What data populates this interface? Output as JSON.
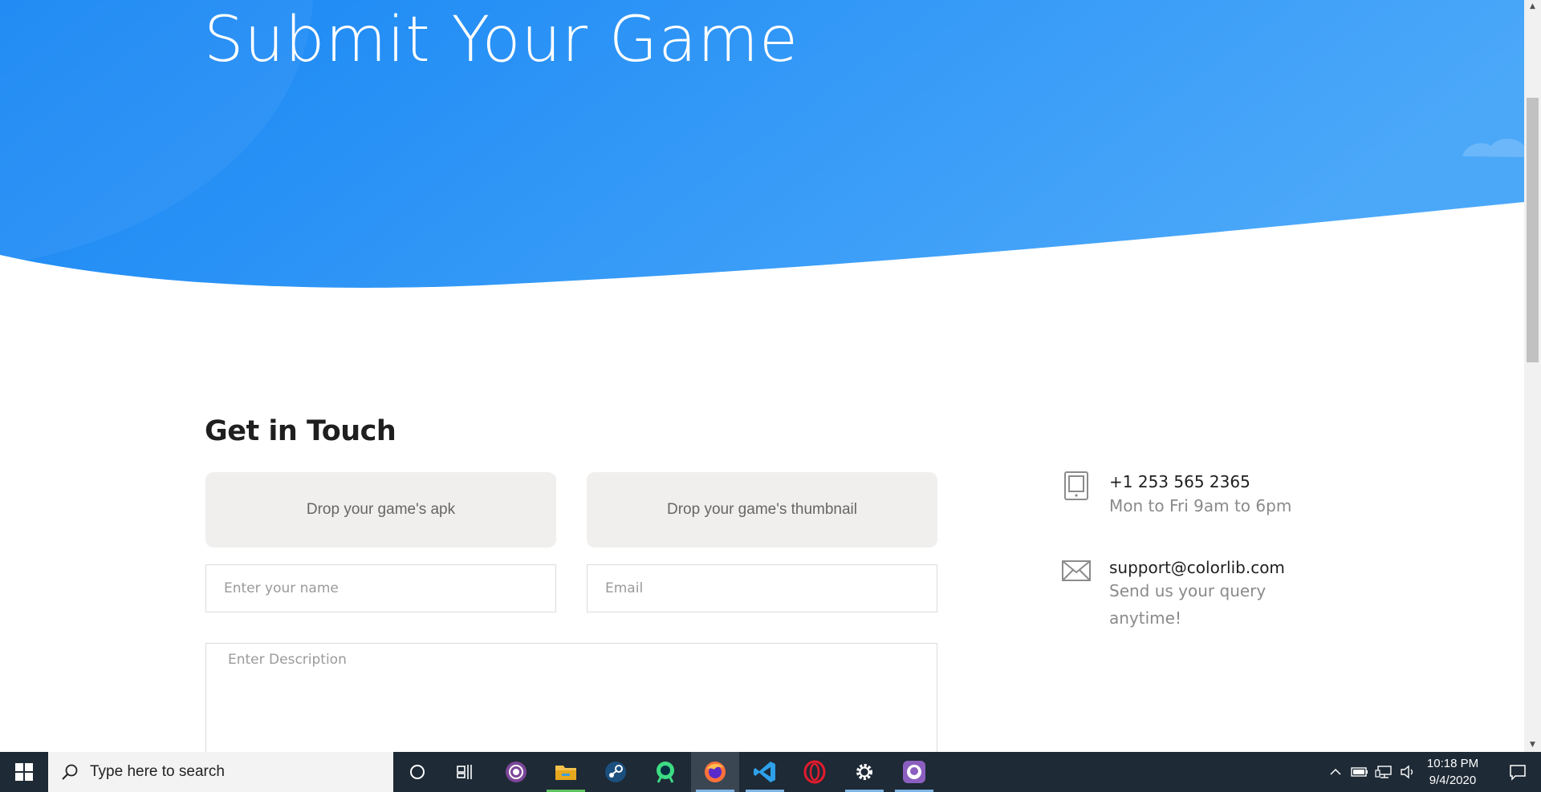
{
  "hero": {
    "title": "Submit Your Game"
  },
  "section": {
    "title": "Get in Touch"
  },
  "form": {
    "apk_drop_label": "Drop your game's apk",
    "thumbnail_drop_label": "Drop your game's thumbnail",
    "name_placeholder": "Enter your name",
    "email_placeholder": "Email",
    "description_placeholder": "Enter Description"
  },
  "contact": {
    "phone": "+1 253 565 2365",
    "phone_hours": "Mon to Fri 9am to 6pm",
    "email": "support@colorlib.com",
    "email_note": "Send us your query anytime!"
  },
  "taskbar": {
    "search_placeholder": "Type here to search",
    "apps": [
      "cortana-icon",
      "task-view-icon",
      "tor-browser-icon",
      "file-explorer-icon",
      "steam-icon",
      "android-studio-icon",
      "firefox-icon",
      "vscode-icon",
      "opera-icon",
      "settings-icon",
      "github-desktop-icon"
    ],
    "clock_time": "10:18 PM",
    "clock_date": "9/4/2020"
  },
  "colors": {
    "hero_start": "#1a86f3",
    "hero_end": "#4aa6f8",
    "field_border": "#dcdcdc",
    "taskbar": "#1e2a36"
  }
}
